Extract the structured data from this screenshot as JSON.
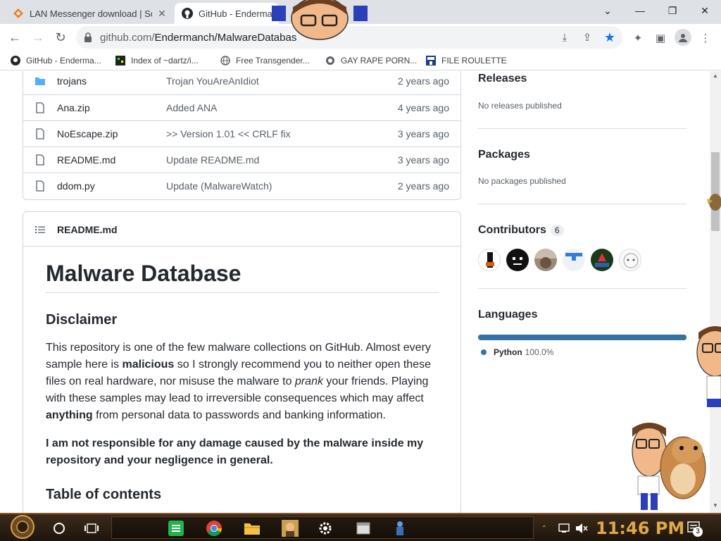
{
  "browser": {
    "tabs": [
      {
        "title": "LAN Messenger download | Sou",
        "active": false
      },
      {
        "title": "GitHub - Enderma",
        "active": true
      }
    ],
    "url_host": "github.com/",
    "url_path": "Endermanch/MalwareDatabas",
    "bookmarks": [
      {
        "label": "GitHub - Enderma...",
        "icon": "github-icon"
      },
      {
        "label": "Index of ~dartz/i...",
        "icon": "pixel-icon"
      },
      {
        "label": "Free Transgender...",
        "icon": "globe-icon"
      },
      {
        "label": "GAY RAPE PORN...",
        "icon": "globe-icon"
      },
      {
        "label": "FILE ROULETTE",
        "icon": "file-roulette-icon"
      }
    ]
  },
  "files": [
    {
      "name": "trojans",
      "message": "Trojan YouAreAnIdiot",
      "age": "2 years ago",
      "type": "folder"
    },
    {
      "name": "Ana.zip",
      "message": "Added ANA",
      "age": "4 years ago",
      "type": "file"
    },
    {
      "name": "NoEscape.zip",
      "message": ">> Version 1.01 << CRLF fix",
      "age": "3 years ago",
      "type": "file"
    },
    {
      "name": "README.md",
      "message": "Update README.md",
      "age": "3 years ago",
      "type": "file"
    },
    {
      "name": "ddom.py",
      "message": "Update (MalwareWatch)",
      "age": "2 years ago",
      "type": "file"
    }
  ],
  "readme": {
    "file_title": "README.md",
    "h1": "Malware Database",
    "h2_disclaimer": "Disclaimer",
    "p1_a": "This repository is one of the few malware collections on GitHub. Almost every sample here is ",
    "p1_bold1": "malicious",
    "p1_b": " so I strongly recommend you to neither open these files on real hardware, nor misuse the malware to ",
    "p1_em": "prank",
    "p1_c": " your friends. Playing with these samples may lead to irreversible consequences which may affect ",
    "p1_bold2": "anything",
    "p1_d": " from personal data to passwords and banking information.",
    "p2": "I am not responsible for any damage caused by the malware inside my repository and your negligence in general.",
    "h2_toc": "Table of contents"
  },
  "sidebar": {
    "releases_title": "Releases",
    "releases_text": "No releases published",
    "packages_title": "Packages",
    "packages_text": "No packages published",
    "contributors_title": "Contributors",
    "contributors_count": "6",
    "languages_title": "Languages",
    "language_name": "Python",
    "language_pct": "100.0%",
    "language_fraction": 1.0,
    "language_color": "#3572A5"
  },
  "taskbar": {
    "clock": "11:46 PM",
    "notification_count": "3"
  }
}
